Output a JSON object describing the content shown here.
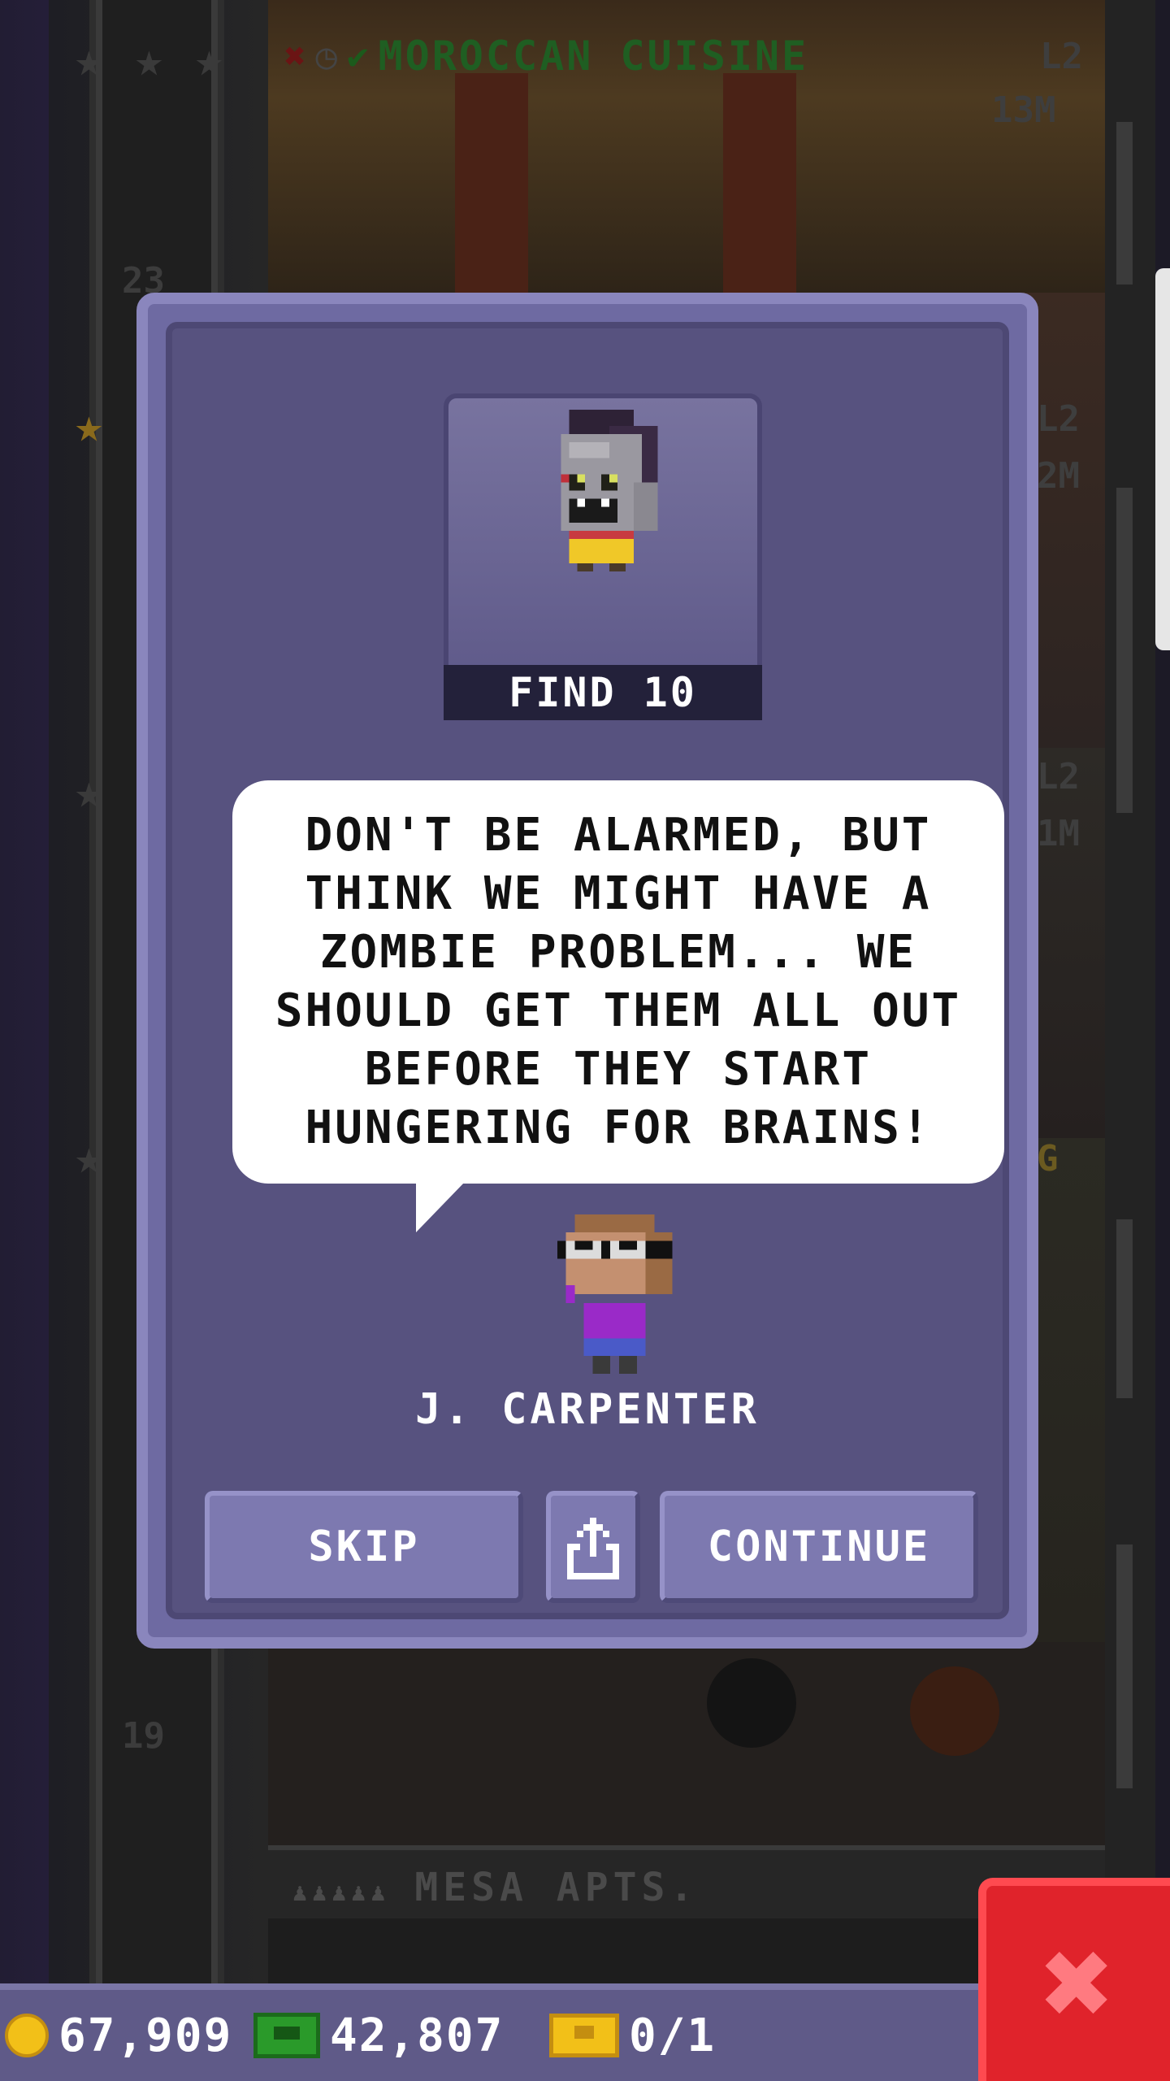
{
  "tower": {
    "top_floor": {
      "name": "MOROCCAN CUISINE",
      "level": "L2",
      "stock": "13M",
      "x_icon": "close-icon",
      "clock_icon": "clock-icon",
      "check_icon": "check-icon"
    },
    "floor_numbers": [
      "23",
      "19"
    ],
    "side_tags": [
      "L2",
      "2M",
      "L2",
      "1M",
      "G"
    ],
    "apartment": {
      "name": "MESA APTS."
    }
  },
  "dialog": {
    "portrait_label": "FIND 10",
    "message": "DON'T BE ALARMED, BUT THINK WE MIGHT HAVE A ZOMBIE PROBLEM... WE SHOULD GET THEM ALL OUT BEFORE THEY START HUNGERING FOR BRAINS!",
    "speaker_name": "J. CARPENTER",
    "buttons": {
      "skip": "SKIP",
      "share_icon": "share-icon",
      "continue": "CONTINUE"
    }
  },
  "hud": {
    "coins": "67,909",
    "bux": "42,807",
    "tickets": "0/1"
  },
  "colors": {
    "dialog": "#6e6aa2",
    "dialog_inner": "#57527f",
    "bubble": "#ffffff",
    "close": "#e0232b",
    "coin": "#f2c018",
    "bux": "#2a9a2a"
  }
}
